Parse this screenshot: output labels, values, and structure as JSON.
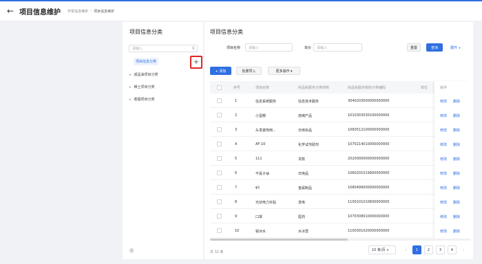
{
  "header": {
    "back_icon": "arrow-left-icon",
    "title": "项目信息维护",
    "breadcrumb": [
      "开票信息维护",
      "项目信息维护"
    ]
  },
  "sidebar": {
    "title": "项目信息分类",
    "search_placeholder": "请输入",
    "items": [
      {
        "label": "项目信息分类",
        "active": true
      },
      {
        "label": "成品油项目分类"
      },
      {
        "label": "稀土项目分类"
      },
      {
        "label": "卷烟项目分类"
      }
    ],
    "add_symbol": "+",
    "footer_icon": "menu-icon",
    "footer_symbol": "☰"
  },
  "main": {
    "title": "项目信息分类",
    "filters": {
      "name_label": "项目名称",
      "name_placeholder": "请输入",
      "unit_label": "单价",
      "unit_placeholder": "请输入",
      "reset": "重置",
      "query": "查询",
      "expand": "展开 ∨"
    },
    "toolbar": {
      "add": "+ 添加",
      "import": "批量导入",
      "more": "更多操作 ▾"
    },
    "table": {
      "columns": [
        "序号",
        "项目名称",
        "商品和服务分类简称",
        "商品和服务税收分类编码",
        "单位",
        "操作"
      ],
      "rows": [
        {
          "no": "1",
          "name": "信息系统服务",
          "short": "信息技术服务",
          "code": "3040203000000000000"
        },
        {
          "no": "2",
          "name": "小蛋糕",
          "short": "焙烤产品",
          "code": "1010303030100000000"
        },
        {
          "no": "3",
          "name": "头发装饰用...",
          "short": "日用杂品",
          "code": "1060512100000000000"
        },
        {
          "no": "4",
          "name": "AF-10",
          "short": "化学试剂助剂",
          "code": "1070214010000000000"
        },
        {
          "no": "5",
          "name": "111",
          "short": "贷款",
          "code": "2020000000000000000"
        },
        {
          "no": "6",
          "name": "不是子😄",
          "short": "日用品",
          "code": "1060201019900000000"
        },
        {
          "no": "7",
          "name": "φ1",
          "short": "金属制品",
          "code": "1080499000000000000"
        },
        {
          "no": "8",
          "name": "光伏电力补贴",
          "short": "发电",
          "code": "1100101010600000000"
        },
        {
          "no": "9",
          "name": "口罩",
          "short": "医药",
          "code": "1070308010000000000"
        },
        {
          "no": "10",
          "name": "锐冰水",
          "short": "水冰雪",
          "code": "1100301020000000000"
        }
      ],
      "op_edit": "修改",
      "op_delete": "删除"
    },
    "pagination": {
      "total": "共 32 条",
      "page_size": "10 条/页 ∨",
      "prev": "‹",
      "pages": [
        "1",
        "2",
        "3",
        "4"
      ],
      "current": "1",
      "next": "›"
    }
  }
}
